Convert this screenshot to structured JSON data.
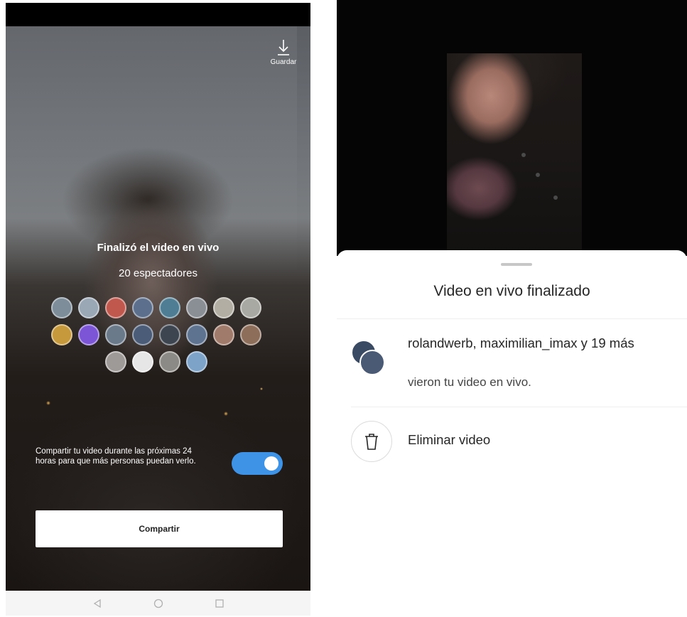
{
  "left_screen": {
    "save_label": "Guardar",
    "ended_title": "Finalizó el video en vivo",
    "viewers_count": "20 espectadores",
    "share_description": "Compartir tu video durante las próximas 24 horas para que más personas puedan verlo.",
    "share_toggle_on": true,
    "share_button_label": "Compartir",
    "nav_icons": [
      "back-icon",
      "home-icon",
      "recents-icon"
    ],
    "colors": {
      "toggle_on": "#3f93e6"
    }
  },
  "right_screen": {
    "sheet_title": "Video en vivo finalizado",
    "viewers_names": "rolandwerb, maximilian_imax y 19 más",
    "viewers_subtitle": "vieron tu video en vivo.",
    "delete_label": "Eliminar video",
    "delete_icon": "trash-icon"
  }
}
